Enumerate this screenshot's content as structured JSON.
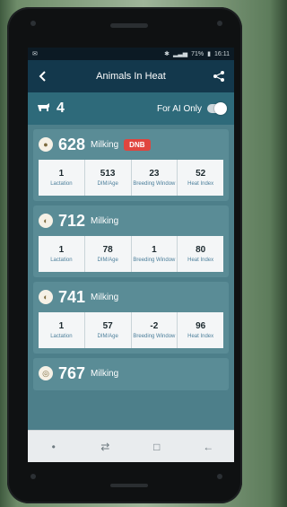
{
  "statusbar": {
    "left_icon": "notification-icon",
    "battery": "71%",
    "time": "16:11"
  },
  "appbar": {
    "title": "Animals In Heat"
  },
  "filter": {
    "count": "4",
    "toggle_label": "For AI Only"
  },
  "animals": [
    {
      "id": "628",
      "status": "Milking",
      "badge": "DNB",
      "stats": [
        {
          "value": "1",
          "label": "Lactation"
        },
        {
          "value": "513",
          "label": "DIM/Age"
        },
        {
          "value": "23",
          "label": "Breeding Window"
        },
        {
          "value": "52",
          "label": "Heat Index"
        }
      ]
    },
    {
      "id": "712",
      "status": "Milking",
      "stats": [
        {
          "value": "1",
          "label": "Lactation"
        },
        {
          "value": "78",
          "label": "DIM/Age"
        },
        {
          "value": "1",
          "label": "Breeding Window"
        },
        {
          "value": "80",
          "label": "Heat Index"
        }
      ]
    },
    {
      "id": "741",
      "status": "Milking",
      "stats": [
        {
          "value": "1",
          "label": "Lactation"
        },
        {
          "value": "57",
          "label": "DIM/Age"
        },
        {
          "value": "-2",
          "label": "Breeding Window"
        },
        {
          "value": "96",
          "label": "Heat Index"
        }
      ]
    },
    {
      "id": "767",
      "status": "Milking"
    }
  ],
  "navbar": {
    "items": [
      "dot",
      "recent",
      "home",
      "back"
    ]
  }
}
